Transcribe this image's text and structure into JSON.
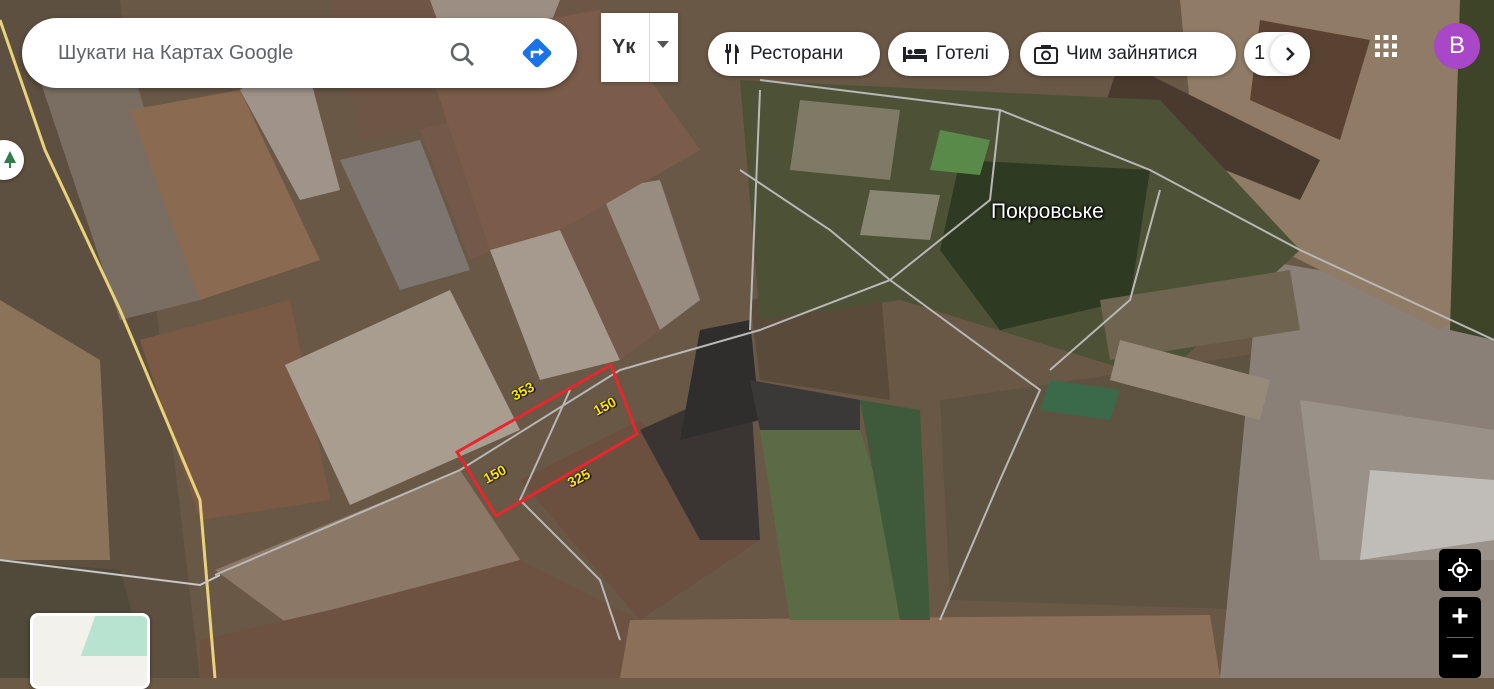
{
  "search": {
    "placeholder": "Шукати на Картах Google"
  },
  "layer_toggle": {
    "label": "Yк"
  },
  "chips": [
    {
      "label": "Ресторани",
      "icon": "fork-knife-icon"
    },
    {
      "label": "Готелі",
      "icon": "bed-icon"
    },
    {
      "label": "Чим зайнятися",
      "icon": "camera-icon"
    }
  ],
  "chip_partial": "1",
  "avatar": {
    "letter": "B",
    "color": "#a847c8"
  },
  "map": {
    "place_label": "Покровське",
    "plot": {
      "outline_color": "#e8262b",
      "side_labels": {
        "top": "353",
        "right": "150",
        "bottom": "325",
        "left": "150"
      },
      "label_color": "#ffe600"
    }
  },
  "controls": {
    "zoom_in": "+",
    "zoom_out": "−"
  }
}
